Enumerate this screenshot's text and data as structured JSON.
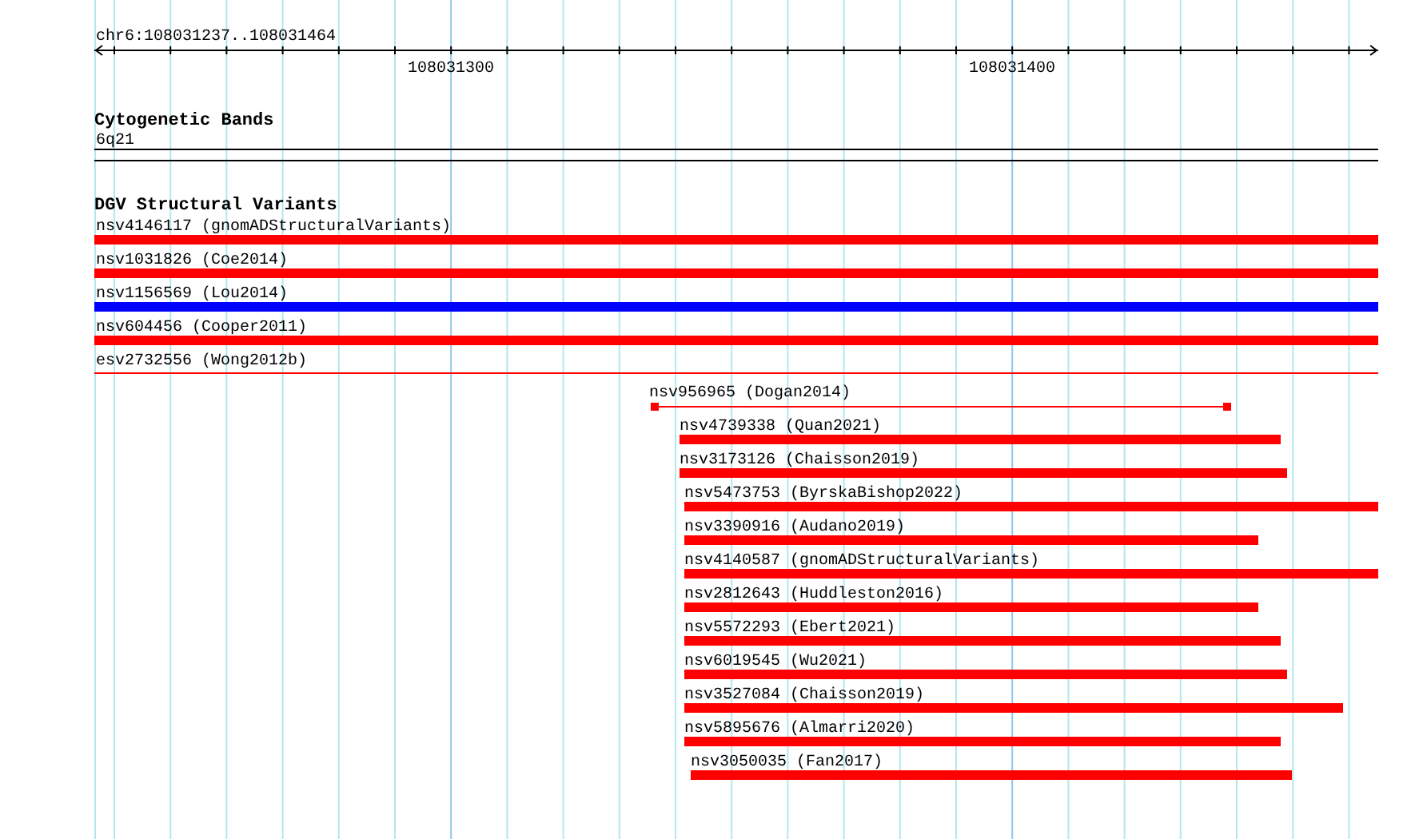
{
  "ruler": {
    "position": "chr6:108031237..108031464",
    "ticks": [
      "108031300",
      "108031400"
    ]
  },
  "cytogenetic_track": {
    "title": "Cytogenetic Bands",
    "band": "6q21"
  },
  "variant_track": {
    "title": "DGV Structural Variants",
    "variants": [
      {
        "label": "nsv4146117 (gnomADStructuralVariants)",
        "kind": "bar",
        "color": "#ff0000"
      },
      {
        "label": "nsv1031826 (Coe2014)",
        "kind": "bar",
        "color": "#ff0000"
      },
      {
        "label": "nsv1156569 (Lou2014)",
        "kind": "bar",
        "color": "#0000ff"
      },
      {
        "label": "nsv604456 (Cooper2011)",
        "kind": "bar",
        "color": "#ff0000"
      },
      {
        "label": "esv2732556 (Wong2012b)",
        "kind": "line",
        "color": "#ff0000"
      },
      {
        "label": "nsv956965 (Dogan2014)",
        "kind": "ends",
        "color": "#ff0000"
      },
      {
        "label": "nsv4739338 (Quan2021)",
        "kind": "bar",
        "color": "#ff0000"
      },
      {
        "label": "nsv3173126 (Chaisson2019)",
        "kind": "bar",
        "color": "#ff0000"
      },
      {
        "label": "nsv5473753 (ByrskaBishop2022)",
        "kind": "bar",
        "color": "#ff0000"
      },
      {
        "label": "nsv3390916 (Audano2019)",
        "kind": "bar",
        "color": "#ff0000"
      },
      {
        "label": "nsv4140587 (gnomADStructuralVariants)",
        "kind": "bar",
        "color": "#ff0000"
      },
      {
        "label": "nsv2812643 (Huddleston2016)",
        "kind": "bar",
        "color": "#ff0000"
      },
      {
        "label": "nsv5572293 (Ebert2021)",
        "kind": "bar",
        "color": "#ff0000"
      },
      {
        "label": "nsv6019545 (Wu2021)",
        "kind": "bar",
        "color": "#ff0000"
      },
      {
        "label": "nsv3527084 (Chaisson2019)",
        "kind": "bar",
        "color": "#ff0000"
      },
      {
        "label": "nsv5895676 (Almarri2020)",
        "kind": "bar",
        "color": "#ff0000"
      },
      {
        "label": "nsv3050035 (Fan2017)",
        "kind": "bar",
        "color": "#ff0000"
      }
    ]
  }
}
